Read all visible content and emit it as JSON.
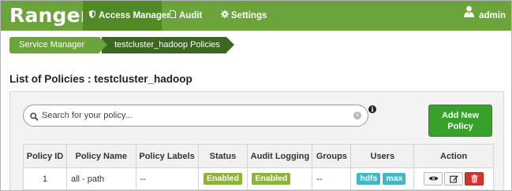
{
  "navbar": {
    "brand": "Ranger",
    "items": [
      {
        "label": "Access Manager",
        "icon": "shield-icon",
        "active": true
      },
      {
        "label": "Audit",
        "icon": "file-icon",
        "active": false
      },
      {
        "label": "Settings",
        "icon": "gear-icon",
        "active": false
      }
    ],
    "user": {
      "label": "admin",
      "icon": "user-icon"
    }
  },
  "breadcrumb": [
    "Service Manager",
    "testcluster_hadoop Policies"
  ],
  "page_title": "List of Policies : testcluster_hadoop",
  "search": {
    "placeholder": "Search for your policy..."
  },
  "add_button": {
    "line1": "Add New",
    "line2": "Policy"
  },
  "table": {
    "headers": [
      "Policy ID",
      "Policy Name",
      "Policy Labels",
      "Status",
      "Audit Logging",
      "Groups",
      "Users",
      "Action"
    ],
    "rows": [
      {
        "policy_id": "1",
        "policy_name": "all - path",
        "policy_labels": "--",
        "status": "Enabled",
        "audit_logging": "Enabled",
        "groups": "--",
        "users": [
          "hdfs",
          "max"
        ],
        "actions": [
          "view-icon",
          "edit-icon",
          "delete-icon"
        ]
      }
    ]
  },
  "colors": {
    "navbar": "#6aa43a",
    "navbar_active": "#4f8a24",
    "breadcrumb_active": "#3d6621",
    "add_button": "#37a12a",
    "status_badge": "#8db33a",
    "user_badge": "#40b8c8",
    "delete_button": "#d8322d"
  }
}
